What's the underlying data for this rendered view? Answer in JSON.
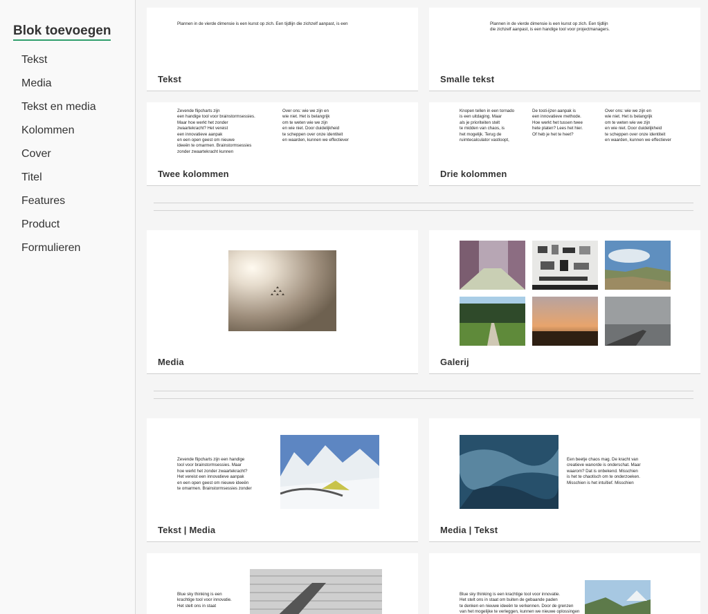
{
  "sidebar": {
    "title": "Blok toevoegen",
    "items": [
      "Tekst",
      "Media",
      "Tekst en media",
      "Kolommen",
      "Cover",
      "Titel",
      "Features",
      "Product",
      "Formulieren"
    ]
  },
  "cards": {
    "tekst": {
      "label": "Tekst",
      "line1": "Plannen in de vierde dimensie is een kunst op zich. Een tijdlijn die zichzelf aanpast, is een"
    },
    "smalle": {
      "label": "Smalle tekst",
      "lines": "Plannen in de vierde dimensie is een kunst op zich. Een tijdlijn\ndie zichzelf aanpast, is een handige tool voor projectmanagers."
    },
    "twee": {
      "label": "Twee kolommen",
      "col1": "Zevende flipcharts zijn\neen handige tool voor brainstormsessies.\nMaar hoe werkt het zonder\nzwaartekracht? Het vereist\neen innovatieve aanpak\nen een open geest om nieuwe\nideeën te omarmen. Brainstormsessies\nzonder zwaartekracht kunnen",
      "col2": "Over ons: wie we zijn en\nwie niet. Het is belangrijk\nom te weten wie we zijn\nen wie niet. Door duidelijkheid\nte scheppen over onze identiteit\nen waarden, kunnen we effectiever"
    },
    "drie": {
      "label": "Drie kolommen",
      "col1": "Knopen tellen in een tornado\nis een uitdaging. Maar\nals je prioriteiten stelt\nte midden van chaos, is\nhet mogelijk. Terug de\nruimtecalculator vastloopt,",
      "col2": "De tosti-ijzer-aanpak is\neen innovatieve methode.\nHoe werkt het tussen twee\nhete platen? Lees het hier.\nOf heb je het te heet?",
      "col3": "Over ons: wie we zijn en\nwie niet. Het is belangrijk\nom te weten wie we zijn\nen wie niet. Door duidelijkheid\nte scheppen over onze identiteit\nen waarden, kunnen we effectiever"
    },
    "media": {
      "label": "Media"
    },
    "galerij": {
      "label": "Galerij"
    },
    "tekstmedia": {
      "label": "Tekst | Media",
      "text": "Zevende flipcharts zijn een handige\ntool voor brainstormsessies. Maar\nhoe werkt het zonder zwaartekracht?\nHet vereist een innovatieve aanpak\nen een open geest om nieuwe ideeën\nte omarmen. Brainstormsessies zonder"
    },
    "mediatekst": {
      "label": "Media | Tekst",
      "text": "Een beetje chaos mag. De kracht van\ncreatieve wanorde is onderschat. Maar\nwaarom? Dat is onbekend. Misschien\nis het te chaotisch om te onderzoeken.\nMisschien is het intuïtief. Misschien"
    },
    "row5a": {
      "text": "Blue sky thinking is een\nkrachtige tool voor innovatie.\nHet stelt ons in staat"
    },
    "row5b": {
      "text": "Blue sky thinking is een krachtige tool voor innovatie.\nHet stelt ons in staat om buiten de gebaande paden\nte denken en nieuwe ideeën te verkennen. Door de grenzen\nvan het mogelijke te verleggen, kunnen we nieuwe oplossingen"
    }
  }
}
